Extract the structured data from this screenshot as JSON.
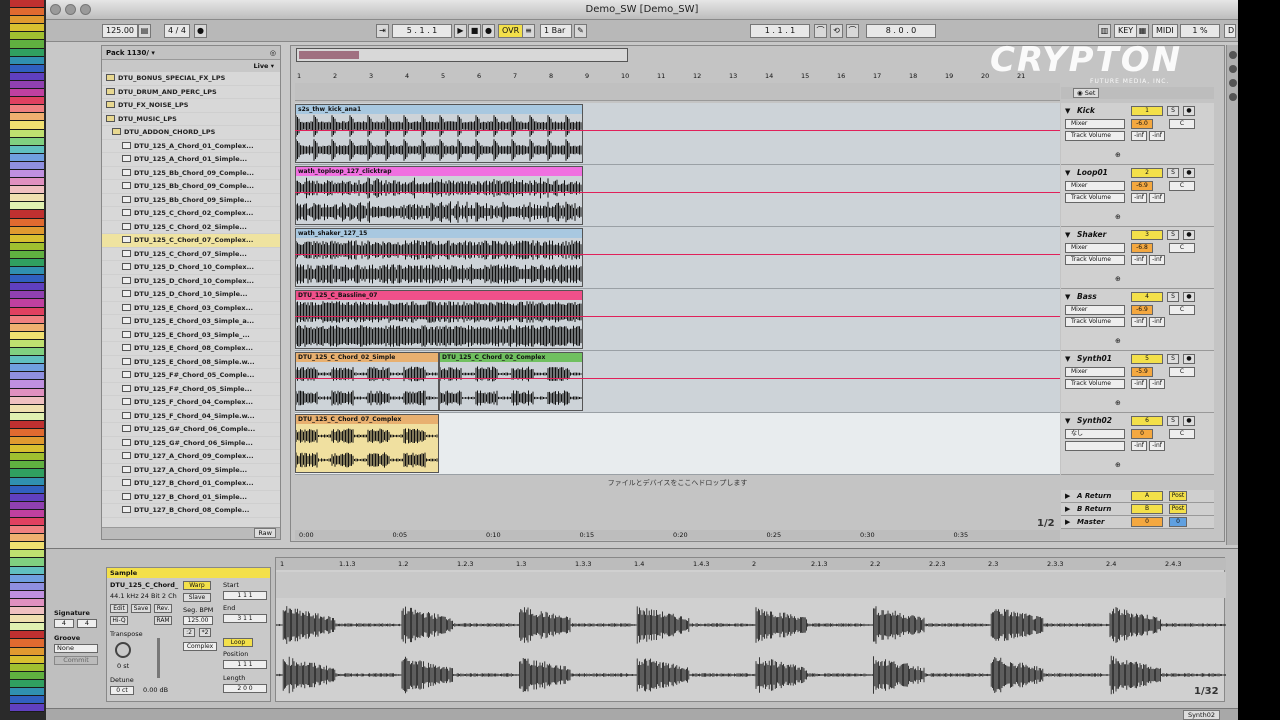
{
  "window": {
    "title": "Demo_SW  [Demo_SW]"
  },
  "control_bar": {
    "tempo": "125.00",
    "signature_num": "4",
    "signature_den": "4",
    "position": "5 . 1 . 1",
    "ovr_label": "OVR",
    "quantize": "1 Bar",
    "loop_start": "1 . 1 . 1",
    "loop_length": "8 . 0 . 0",
    "key_label": "KEY",
    "midi_label": "MIDI",
    "cpu": "1 %",
    "d_label": "D"
  },
  "browser": {
    "pack": "Pack 1130/",
    "view": "Live",
    "items": [
      {
        "label": "DTU_BONUS_SPECIAL_FX_LPS",
        "folder": true
      },
      {
        "label": "DTU_DRUM_AND_PERC_LPS",
        "folder": true
      },
      {
        "label": "DTU_FX_NOISE_LPS",
        "folder": true
      },
      {
        "label": "DTU_MUSIC_LPS",
        "folder": true
      },
      {
        "label": "DTU_ADDON_CHORD_LPS",
        "folder": true,
        "open": true
      },
      {
        "label": "DTU_125_A_Chord_01_Complex..."
      },
      {
        "label": "DTU_125_A_Chord_01_Simple..."
      },
      {
        "label": "DTU_125_Bb_Chord_09_Comple..."
      },
      {
        "label": "DTU_125_Bb_Chord_09_Comple..."
      },
      {
        "label": "DTU_125_Bb_Chord_09_Simple..."
      },
      {
        "label": "DTU_125_C_Chord_02_Complex..."
      },
      {
        "label": "DTU_125_C_Chord_02_Simple..."
      },
      {
        "label": "DTU_125_C_Chord_07_Complex...",
        "selected": true
      },
      {
        "label": "DTU_125_C_Chord_07_Simple..."
      },
      {
        "label": "DTU_125_D_Chord_10_Complex..."
      },
      {
        "label": "DTU_125_D_Chord_10_Complex..."
      },
      {
        "label": "DTU_125_D_Chord_10_Simple..."
      },
      {
        "label": "DTU_125_E_Chord_03_Complex..."
      },
      {
        "label": "DTU_125_E_Chord_03_Simple_a..."
      },
      {
        "label": "DTU_125_E_Chord_03_Simple_..."
      },
      {
        "label": "DTU_125_E_Chord_08_Complex..."
      },
      {
        "label": "DTU_125_E_Chord_08_Simple.w..."
      },
      {
        "label": "DTU_125_F#_Chord_05_Comple..."
      },
      {
        "label": "DTU_125_F#_Chord_05_Simple..."
      },
      {
        "label": "DTU_125_F_Chord_04_Complex..."
      },
      {
        "label": "DTU_125_F_Chord_04_Simple.w..."
      },
      {
        "label": "DTU_125_G#_Chord_06_Comple..."
      },
      {
        "label": "DTU_125_G#_Chord_06_Simple..."
      },
      {
        "label": "DTU_127_A_Chord_09_Complex..."
      },
      {
        "label": "DTU_127_A_Chord_09_Simple..."
      },
      {
        "label": "DTU_127_B_Chord_01_Complex..."
      },
      {
        "label": "DTU_127_B_Chord_01_Simple..."
      },
      {
        "label": "DTU_127_B_Chord_08_Comple..."
      }
    ],
    "raw_label": "Raw"
  },
  "arrangement": {
    "bar_ruler": [
      "1",
      "2",
      "3",
      "4",
      "5",
      "6",
      "7",
      "8",
      "9",
      "10",
      "11",
      "12",
      "13",
      "14",
      "15",
      "16",
      "17",
      "18",
      "19",
      "20",
      "21"
    ],
    "time_ruler": [
      "0:00",
      "0:05",
      "0:10",
      "0:15",
      "0:20",
      "0:25",
      "0:30",
      "0:35"
    ],
    "drop_text": "ファイルとデバイスをここへドロップします",
    "page": "1/2",
    "set_label": "Set"
  },
  "tracks": [
    {
      "name": "Kick",
      "num": "1",
      "output": "Mixer",
      "param": "Track Volume",
      "vol": "-6.0",
      "pan": "C",
      "inf1": "-inf",
      "inf2": "-inf",
      "clips": [
        {
          "label": "s2s_thw_kick_ana1",
          "start": 1,
          "end": 9,
          "color": "#a8c8e0",
          "wave": "kick"
        }
      ]
    },
    {
      "name": "Loop01",
      "num": "2",
      "output": "Mixer",
      "param": "Track Volume",
      "vol": "-6.9",
      "pan": "C",
      "inf1": "-inf",
      "inf2": "-inf",
      "clips": [
        {
          "label": "wath_toploop_127_clicktrap",
          "start": 1,
          "end": 9,
          "color": "#f070e0",
          "wave": "loop"
        }
      ]
    },
    {
      "name": "Shaker",
      "num": "3",
      "output": "Mixer",
      "param": "Track Volume",
      "vol": "-6.8",
      "pan": "C",
      "inf1": "-inf",
      "inf2": "-inf",
      "clips": [
        {
          "label": "wath_shaker_127_15",
          "start": 1,
          "end": 9,
          "color": "#a8c8e0",
          "wave": "shaker"
        }
      ]
    },
    {
      "name": "Bass",
      "num": "4",
      "output": "Mixer",
      "param": "Track Volume",
      "vol": "-6.9",
      "pan": "C",
      "inf1": "-inf",
      "inf2": "-inf",
      "clips": [
        {
          "label": "DTU_125_C_Bassline_07",
          "start": 1,
          "end": 9,
          "color": "#f0508a",
          "wave": "bass"
        }
      ]
    },
    {
      "name": "Synth01",
      "num": "5",
      "output": "Mixer",
      "param": "Track Volume",
      "vol": "-5.9",
      "pan": "C",
      "inf1": "-inf",
      "inf2": "-inf",
      "clips": [
        {
          "label": "DTU_125_C_Chord_02_Simple",
          "start": 1,
          "end": 5,
          "color": "#e8b070",
          "wave": "chord"
        },
        {
          "label": "DTU_125_C_Chord_02_Complex",
          "start": 5,
          "end": 9,
          "color": "#70c060",
          "wave": "chord"
        }
      ]
    },
    {
      "name": "Synth02",
      "num": "6",
      "output": "なし",
      "param": "",
      "vol": "0",
      "pan": "C",
      "inf1": "-inf",
      "inf2": "-inf",
      "clips": [
        {
          "label": "DTU_125_C_Chord_07_Complex",
          "start": 1,
          "end": 5,
          "color": "#e8b070",
          "wave": "chord2",
          "body": "#f0e0a0"
        }
      ]
    }
  ],
  "returns": [
    {
      "name": "A Return",
      "letter": "A",
      "post": "Post"
    },
    {
      "name": "B Return",
      "letter": "B",
      "post": "Post"
    },
    {
      "name": "Master",
      "letter": "0",
      "post": "0"
    }
  ],
  "clip_view": {
    "title": "Sample",
    "file": "DTU_125_C_Chord_",
    "format": "44.1 kHz 24 Bit 2 Ch",
    "edit": "Edit",
    "save": "Save",
    "rev": "Rev.",
    "hiq": "Hi-Q",
    "ram": "RAM",
    "warp": "Warp",
    "slave": "Slave",
    "seg_bpm_label": "Seg. BPM",
    "seg_bpm": "125.00",
    "mode": "Complex",
    "transpose_label": "Transpose",
    "transpose": "0 st",
    "detune_label": "Detune",
    "detune": "0 ct",
    "gain": "0.00 dB",
    "start_label": "Start",
    "end_label": "End",
    "loop_label": "Loop",
    "position_label": "Position",
    "length_label": "Length",
    "start_val": "1  1  1",
    "end_val": "3  1  1",
    "pos_val": "1  1  1",
    "len_val": "2  0  0",
    "signature_label": "Signature",
    "sig_num": "4",
    "sig_den": "4",
    "groove_label": "Groove",
    "groove": "None",
    "commit": "Commit",
    "ruler": [
      "1",
      "1.1.3",
      "1.2",
      "1.2.3",
      "1.3",
      "1.3.3",
      "1.4",
      "1.4.3",
      "2",
      "2.1.3",
      "2.2",
      "2.2.3",
      "2.3",
      "2.3.3",
      "2.4",
      "2.4.3"
    ],
    "page": "1/32"
  },
  "logo": {
    "text": "CRYPTON",
    "sub": "FUTURE MEDIA, INC."
  },
  "status": {
    "track": "Synth02"
  }
}
